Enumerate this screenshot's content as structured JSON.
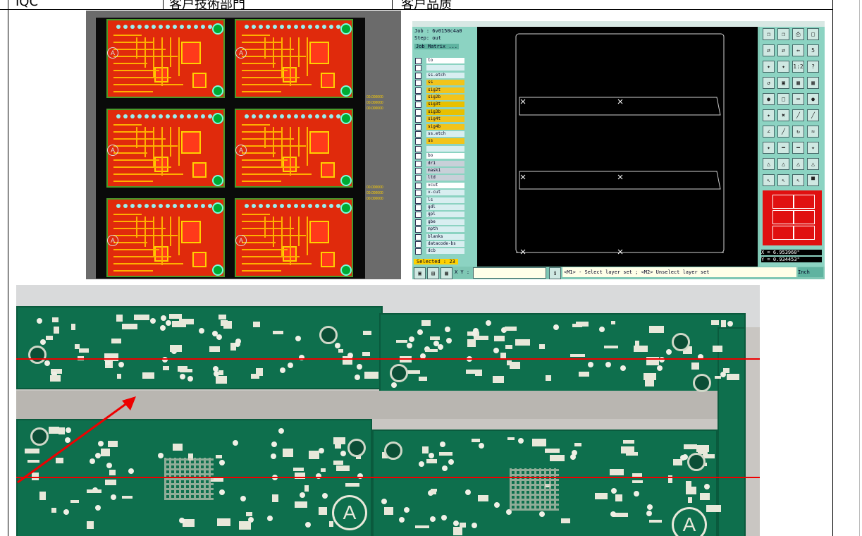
{
  "header": {
    "col1": "IQC",
    "col2": "客户技術部門",
    "col3": "客户品质"
  },
  "cam": {
    "job": "Job : 6v0150c4a0",
    "step": "Step: out",
    "matrix": "Job Matrix ...",
    "layers": [
      "to",
      "",
      "ss.etch",
      "ss",
      "sig2t",
      "sig2b",
      "sig3t",
      "sig3b",
      "sig4t",
      "sig4b",
      "ss.etch",
      "ss",
      "",
      "bo",
      "dr1",
      "mask1",
      "ltd",
      "vcut",
      "v-cut",
      "ls",
      "gdl",
      "gpl",
      "gbe",
      "mpth",
      "blanks",
      "datacode-bs",
      "dcb"
    ],
    "selected": "Selected : 23",
    "xy_label": "X Y :",
    "status": "<M1> - Select layer set ; <M2> Unselect layer set",
    "unit": "Inch",
    "x_coord": "X = 6.953960\"",
    "y_coord": "Y = 0.934453\"",
    "tools": [
      "❐",
      "❐",
      "⎙",
      "□",
      "⇄",
      "⇄",
      "↔",
      "5",
      "✦",
      "✦",
      "1:2",
      "?",
      "↺",
      "▣",
      "▦",
      "▦",
      "●",
      "□",
      "━",
      "●",
      "✦",
      "✖",
      "╱",
      "╱",
      "∠",
      "╱",
      "↻",
      "≈",
      "✦",
      "━",
      "━",
      "✦",
      "△",
      "△",
      "△",
      "△",
      "↖",
      "↖",
      "↖",
      "▀"
    ]
  },
  "pcb_panel": {
    "boards": 6,
    "markers": [
      "00.000000",
      "00.000000",
      "00.000000",
      "00.000000",
      "00.000000",
      "00.000000"
    ]
  },
  "photo": {
    "board_symbol": "A"
  }
}
